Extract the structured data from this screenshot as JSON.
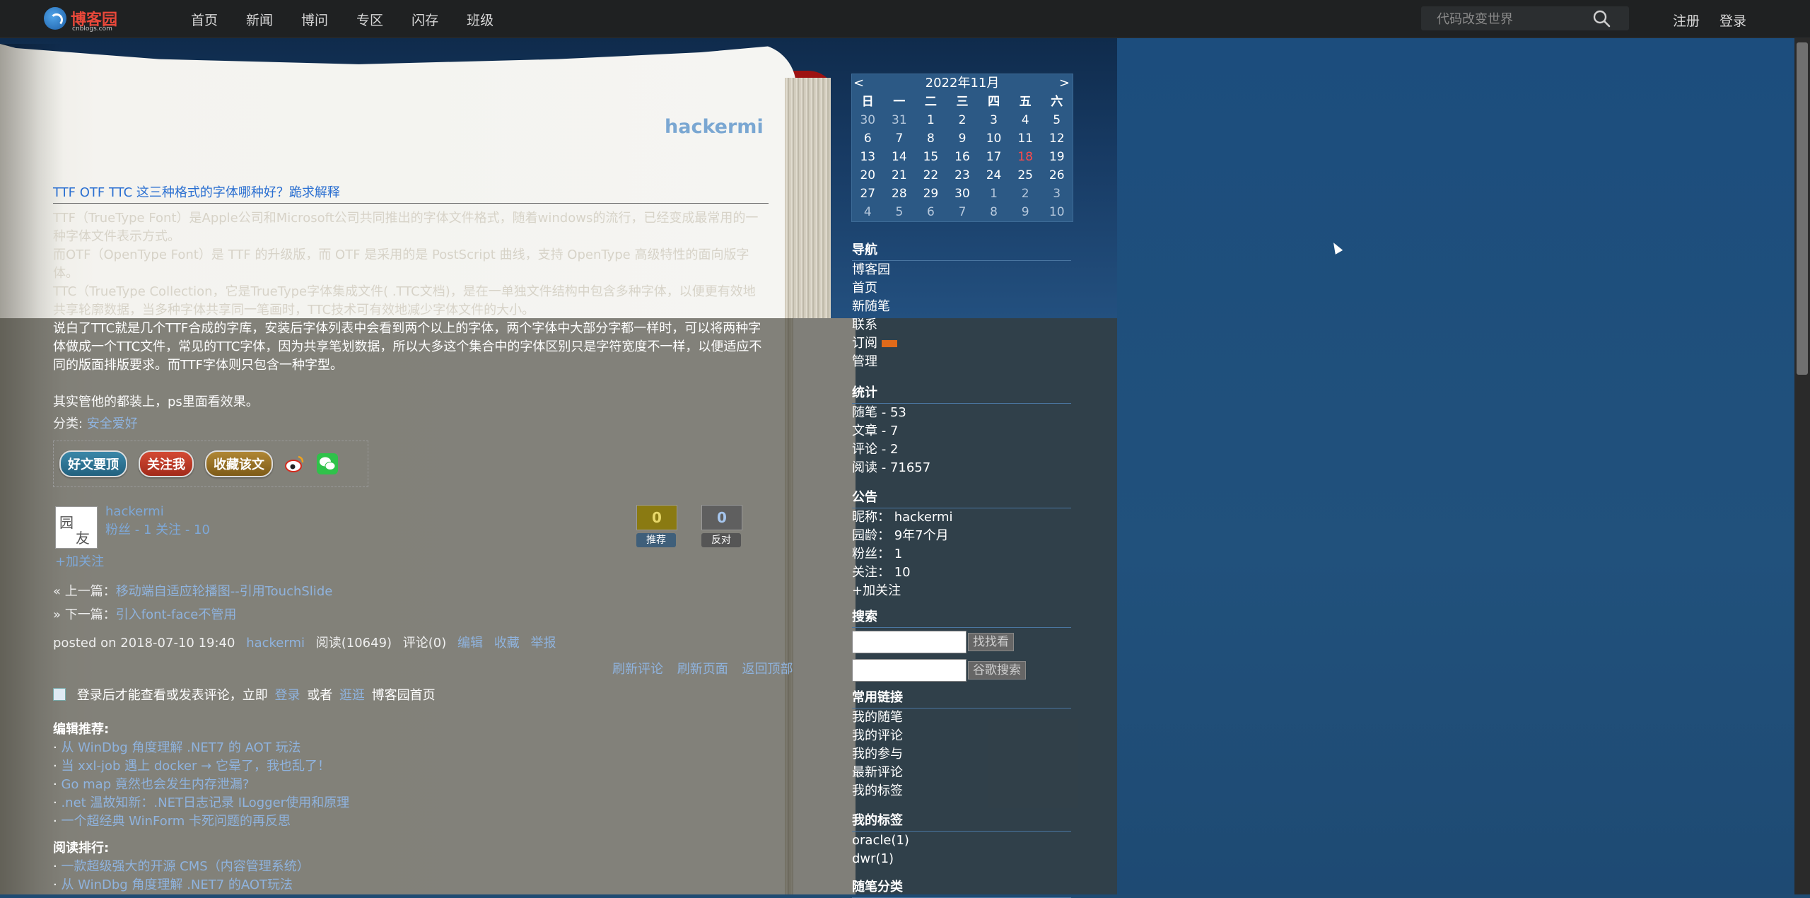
{
  "header": {
    "logo_text": "博客园",
    "logo_sub": "cnblogs.com",
    "nav": [
      "首页",
      "新闻",
      "博问",
      "专区",
      "闪存",
      "班级"
    ],
    "search_placeholder": "代码改变世界",
    "register": "注册",
    "login": "登录"
  },
  "blog": {
    "title": "hackermi"
  },
  "post": {
    "title": "TTF OTF TTC 这三种格式的字体哪种好？跪求解释",
    "body": [
      "TTF（TrueType Font）是Apple公司和Microsoft公司共同推出的字体文件格式，随着windows的流行，已经变成最常用的一种字体文件表示方式。",
      "而OTF（OpenType Font）是 TTF 的升级版，而 OTF 是采用的是 PostScript 曲线，支持 OpenType 高级特性的面向版字体。",
      "TTC（TrueType Collection，它是TrueType字体集成文件( .TTC文档)，是在一单独文件结构中包含多种字体，以便更有效地共享轮廓数据，当多种字体共享同一笔画时，TTC技术可有效地减少字体文件的大小。",
      "说白了TTC就是几个TTF合成的字库，安装后字体列表中会看到两个以上的字体，两个字体中大部分字都一样时，可以将两种字体做成一个TTC文件，常见的TTC字体，因为共享笔划数据，所以大多这个集合中的字体区别只是字符宽度不一样，以便适应不同的版面排版要求。而TTF字体则只包含一种字型。",
      "其实管他的都装上，ps里面看效果。"
    ],
    "category_label": "分类:",
    "category": "安全爱好",
    "share": {
      "recommend": "好文要顶",
      "follow": "关注我",
      "favorite": "收藏该文"
    },
    "author": {
      "name": "hackermi",
      "stats": "粉丝 - 1 关注 - 10",
      "add_follow": "+加关注"
    },
    "votes": {
      "up_count": "0",
      "up_label": "推荐",
      "down_count": "0",
      "down_label": "反对"
    },
    "prev_label": "« 上一篇：",
    "prev_link": "移动端自适应轮播图--引用TouchSlide",
    "next_label": "» 下一篇：",
    "next_link": "引入font-face不管用",
    "meta_posted": "posted on 2018-07-10 19:40",
    "meta_author": "hackermi",
    "meta_reads": "阅读(10649)",
    "meta_comments": "评论(0)",
    "meta_edit": "编辑",
    "meta_fav": "收藏",
    "meta_report": "举报",
    "refresh_comments": "刷新评论",
    "refresh_page": "刷新页面",
    "back_top": "返回顶部",
    "login_hint_pre": "登录后才能查看或发表评论，立即",
    "login_link": "登录",
    "login_hint_or": "或者",
    "browse_link": "逛逛",
    "login_hint_post": "博客园首页"
  },
  "editor_recommend": {
    "title": "编辑推荐:",
    "items": [
      "从 WinDbg 角度理解 .NET7 的 AOT 玩法",
      "当 xxl-job 遇上 docker → 它晕了，我也乱了！",
      "Go map 竟然也会发生内存泄漏?",
      ".net 温故知新：.NET日志记录 ILogger使用和原理",
      "一个超经典 WinForm 卡死问题的再反思"
    ]
  },
  "read_rank": {
    "title": "阅读排行:",
    "items": [
      "一款超级强大的开源 CMS（内容管理系统）",
      "从 WinDbg 角度理解 .NET7 的AOT玩法"
    ]
  },
  "calendar": {
    "prev": "<",
    "next": ">",
    "title": "2022年11月",
    "weekdays": [
      "日",
      "一",
      "二",
      "三",
      "四",
      "五",
      "六"
    ],
    "days": [
      [
        "30",
        "o"
      ],
      [
        "31",
        "o"
      ],
      [
        "1",
        "d"
      ],
      [
        "2",
        "d"
      ],
      [
        "3",
        "d"
      ],
      [
        "4",
        "d"
      ],
      [
        "5",
        "d"
      ],
      [
        "6",
        "d"
      ],
      [
        "7",
        "d"
      ],
      [
        "8",
        "d"
      ],
      [
        "9",
        "d"
      ],
      [
        "10",
        "d"
      ],
      [
        "11",
        "d"
      ],
      [
        "12",
        "d"
      ],
      [
        "13",
        "d"
      ],
      [
        "14",
        "d"
      ],
      [
        "15",
        "d"
      ],
      [
        "16",
        "d"
      ],
      [
        "17",
        "d"
      ],
      [
        "18",
        "t"
      ],
      [
        "19",
        "d"
      ],
      [
        "20",
        "d"
      ],
      [
        "21",
        "d"
      ],
      [
        "22",
        "d"
      ],
      [
        "23",
        "d"
      ],
      [
        "24",
        "d"
      ],
      [
        "25",
        "d"
      ],
      [
        "26",
        "d"
      ],
      [
        "27",
        "d"
      ],
      [
        "28",
        "d"
      ],
      [
        "29",
        "d"
      ],
      [
        "30",
        "d"
      ],
      [
        "1",
        "o"
      ],
      [
        "2",
        "o"
      ],
      [
        "3",
        "o"
      ],
      [
        "4",
        "o"
      ],
      [
        "5",
        "o"
      ],
      [
        "6",
        "o"
      ],
      [
        "7",
        "o"
      ],
      [
        "8",
        "o"
      ],
      [
        "9",
        "o"
      ],
      [
        "10",
        "o"
      ]
    ]
  },
  "sidebar": {
    "nav_title": "导航",
    "nav_items": [
      "博客园",
      "首页",
      "新随笔",
      "联系",
      "订阅",
      "管理"
    ],
    "stats_title": "统计",
    "stats_items": [
      "随笔 - 53",
      "文章 - 7",
      "评论 - 2",
      "阅读 - 71657"
    ],
    "notice_title": "公告",
    "notice_items": [
      "昵称：  hackermi",
      "园龄：  9年7个月",
      "粉丝：  1",
      "关注：  10",
      "+加关注"
    ],
    "search_title": "搜索",
    "search_btn": "找找看",
    "google_btn": "谷歌搜索",
    "links_title": "常用链接",
    "links_items": [
      "我的随笔",
      "我的评论",
      "我的参与",
      "最新评论",
      "我的标签"
    ],
    "tags_title": "我的标签",
    "tags_items": [
      "oracle(1)",
      "dwr(1)"
    ],
    "category_title": "随笔分类"
  }
}
